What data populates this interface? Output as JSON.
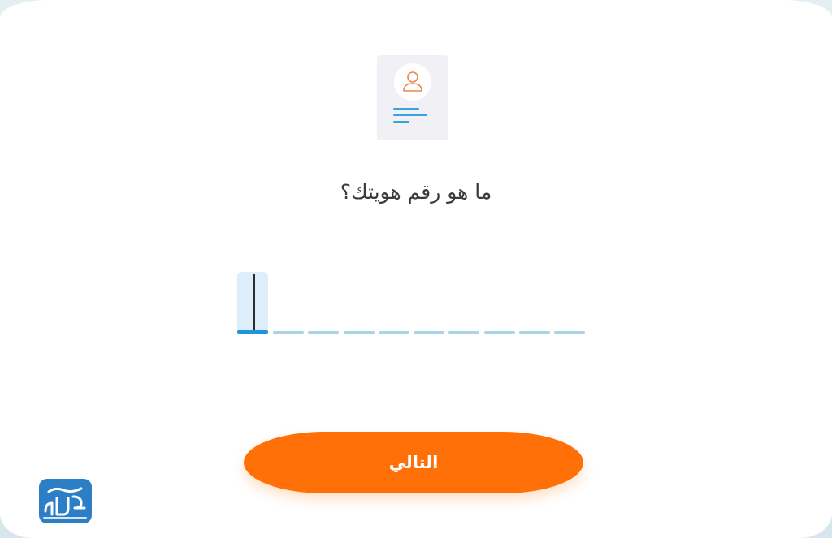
{
  "page": {
    "question": "ما هو رقم هويتك؟",
    "next_button_label": "التالي"
  },
  "id_input": {
    "digit_count": 10,
    "active_index": 0,
    "value": ""
  },
  "logo": {
    "name": "site-logo",
    "text": "المرجع"
  },
  "colors": {
    "accent_orange": "#ff7108",
    "underline_inactive": "#a9d4ea",
    "underline_active": "#1e95d6",
    "active_box": "#ddeefa",
    "avatar_stroke": "#e8874b",
    "id_lines": "#3aa0e0",
    "logo_blue": "#2c7fc7"
  },
  "icons": {
    "id_card": "id-card-icon",
    "avatar": "user-avatar-icon"
  }
}
